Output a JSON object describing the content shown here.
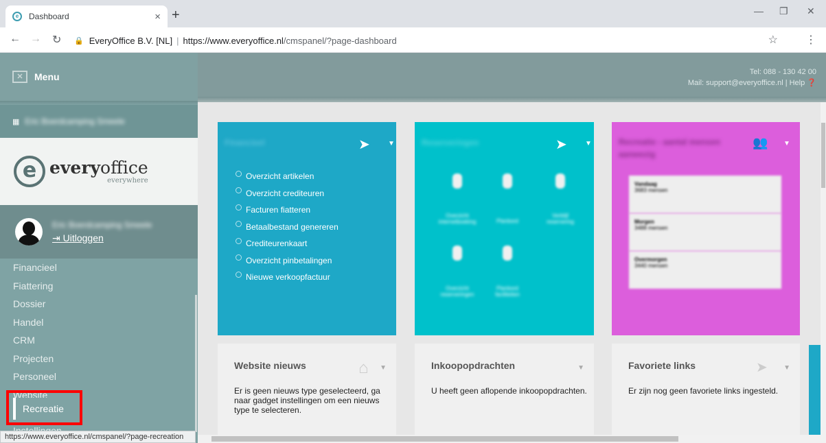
{
  "browser": {
    "tab_title": "Dashboard",
    "tab_close": "×",
    "new_tab": "+",
    "site_identity": "EveryOffice B.V. [NL]",
    "url_host": "https://www.everyoffice.nl",
    "url_path": "/cmspanel/?page-dashboard",
    "status_url": "https://www.everyoffice.nl/cmspanel/?page-recreation"
  },
  "sidebar": {
    "menu_label": "Menu",
    "client_name": "Eric Boerdcamping Smeele",
    "logo_brand_bold": "every",
    "logo_brand_rest": "office",
    "logo_tagline": "everywhere",
    "user_name": "Eric Boerdcamping Smeele",
    "logout_label": "Uitloggen",
    "nav_items": [
      "Financieel",
      "Fiattering",
      "Dossier",
      "Handel",
      "CRM",
      "Projecten",
      "Personeel",
      "Website"
    ],
    "highlighted_item": "Recreatie",
    "partial_item": "Instellingen"
  },
  "header": {
    "phone": "Tel: 088 - 130 42 00",
    "mail_help": "Mail: support@everyoffice.nl | Help"
  },
  "widgets": {
    "financieel": {
      "title": "Financieel",
      "links": [
        "Overzicht artikelen",
        "Overzicht crediteuren",
        "Facturen fiatteren",
        "Betaalbestand genereren",
        "Crediteurenkaart",
        "Overzicht pinbetalingen",
        "Nieuwe verkoopfactuur"
      ]
    },
    "reserveringen": {
      "title": "Reserveringen",
      "icons": [
        "Overzicht internetboeking",
        "Planbord",
        "Verblijf reservering",
        "Overzicht reserveringen",
        "Planbord faciliteiten"
      ]
    },
    "recreatie": {
      "title": "Recreatie - aantal mensen aanwezig",
      "stats": [
        {
          "label": "Vandaag",
          "value": "3683 mensen"
        },
        {
          "label": "Morgen",
          "value": "3488 mensen"
        },
        {
          "label": "Overmorgen",
          "value": "3440 mensen"
        }
      ]
    },
    "website_nieuws": {
      "title": "Website nieuws",
      "body": "Er is geen nieuws type geselecteerd, ga naar gadget instellingen om een nieuws type te selecteren."
    },
    "inkoopopdrachten": {
      "title": "Inkoopopdrachten",
      "body": "U heeft geen aflopende inkoopopdrachten."
    },
    "favoriete_links": {
      "title": "Favoriete links",
      "body": "Er zijn nog geen favoriete links ingesteld."
    }
  },
  "colors": {
    "sidebar": "#7fa3a4",
    "financieel": "#1ea8c7",
    "reserveringen": "#00c1cb",
    "recreatie": "#dc5edc",
    "highlight": "#ff0000"
  }
}
